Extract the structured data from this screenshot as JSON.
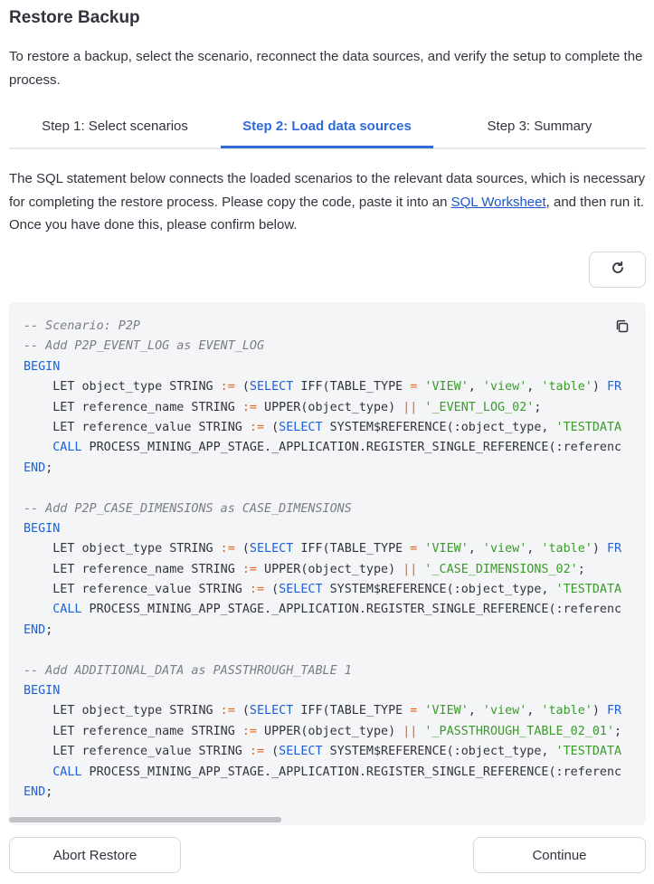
{
  "page": {
    "title": "Restore Backup",
    "intro": "To restore a backup, select the scenario, reconnect the data sources, and verify the setup to complete the process."
  },
  "tabs": [
    {
      "label": "Step 1: Select scenarios",
      "active": false
    },
    {
      "label": "Step 2: Load data sources",
      "active": true
    },
    {
      "label": "Step 3: Summary",
      "active": false
    }
  ],
  "description": {
    "before_link": "The SQL statement below connects the loaded scenarios to the relevant data sources, which is necessary for completing the restore process. Please copy the code, paste it into an ",
    "link_text": "SQL Worksheet",
    "after_link": ", and then run it. Once you have done this, please confirm below."
  },
  "icons": {
    "refresh": "refresh-icon",
    "copy": "copy-icon"
  },
  "code_lines": [
    [
      {
        "t": "-- Scenario: P2P",
        "c": "cm"
      }
    ],
    [
      {
        "t": "-- Add P2P_EVENT_LOG as EVENT_LOG",
        "c": "cm"
      }
    ],
    [
      {
        "t": "BEGIN",
        "c": "kw"
      }
    ],
    [
      {
        "t": "    LET object_type STRING "
      },
      {
        "t": ":=",
        "c": "op"
      },
      {
        "t": " ("
      },
      {
        "t": "SELECT",
        "c": "kw"
      },
      {
        "t": " IFF(TABLE_TYPE "
      },
      {
        "t": "=",
        "c": "op"
      },
      {
        "t": " "
      },
      {
        "t": "'VIEW'",
        "c": "st"
      },
      {
        "t": ", "
      },
      {
        "t": "'view'",
        "c": "st"
      },
      {
        "t": ", "
      },
      {
        "t": "'table'",
        "c": "st"
      },
      {
        "t": ") "
      },
      {
        "t": "FR",
        "c": "kw"
      }
    ],
    [
      {
        "t": "    LET reference_name STRING "
      },
      {
        "t": ":=",
        "c": "op"
      },
      {
        "t": " UPPER(object_type) "
      },
      {
        "t": "||",
        "c": "op"
      },
      {
        "t": " "
      },
      {
        "t": "'_EVENT_LOG_02'",
        "c": "st"
      },
      {
        "t": ";"
      }
    ],
    [
      {
        "t": "    LET reference_value STRING "
      },
      {
        "t": ":=",
        "c": "op"
      },
      {
        "t": " ("
      },
      {
        "t": "SELECT",
        "c": "kw"
      },
      {
        "t": " SYSTEM$REFERENCE(:object_type, "
      },
      {
        "t": "'TESTDATA",
        "c": "st"
      }
    ],
    [
      {
        "t": "    "
      },
      {
        "t": "CALL",
        "c": "kw"
      },
      {
        "t": " PROCESS_MINING_APP_STAGE._APPLICATION.REGISTER_SINGLE_REFERENCE(:referenc"
      }
    ],
    [
      {
        "t": "END",
        "c": "kw"
      },
      {
        "t": ";"
      }
    ],
    [
      {
        "t": ""
      }
    ],
    [
      {
        "t": "-- Add P2P_CASE_DIMENSIONS as CASE_DIMENSIONS",
        "c": "cm"
      }
    ],
    [
      {
        "t": "BEGIN",
        "c": "kw"
      }
    ],
    [
      {
        "t": "    LET object_type STRING "
      },
      {
        "t": ":=",
        "c": "op"
      },
      {
        "t": " ("
      },
      {
        "t": "SELECT",
        "c": "kw"
      },
      {
        "t": " IFF(TABLE_TYPE "
      },
      {
        "t": "=",
        "c": "op"
      },
      {
        "t": " "
      },
      {
        "t": "'VIEW'",
        "c": "st"
      },
      {
        "t": ", "
      },
      {
        "t": "'view'",
        "c": "st"
      },
      {
        "t": ", "
      },
      {
        "t": "'table'",
        "c": "st"
      },
      {
        "t": ") "
      },
      {
        "t": "FR",
        "c": "kw"
      }
    ],
    [
      {
        "t": "    LET reference_name STRING "
      },
      {
        "t": ":=",
        "c": "op"
      },
      {
        "t": " UPPER(object_type) "
      },
      {
        "t": "||",
        "c": "op"
      },
      {
        "t": " "
      },
      {
        "t": "'_CASE_DIMENSIONS_02'",
        "c": "st"
      },
      {
        "t": ";"
      }
    ],
    [
      {
        "t": "    LET reference_value STRING "
      },
      {
        "t": ":=",
        "c": "op"
      },
      {
        "t": " ("
      },
      {
        "t": "SELECT",
        "c": "kw"
      },
      {
        "t": " SYSTEM$REFERENCE(:object_type, "
      },
      {
        "t": "'TESTDATA",
        "c": "st"
      }
    ],
    [
      {
        "t": "    "
      },
      {
        "t": "CALL",
        "c": "kw"
      },
      {
        "t": " PROCESS_MINING_APP_STAGE._APPLICATION.REGISTER_SINGLE_REFERENCE(:referenc"
      }
    ],
    [
      {
        "t": "END",
        "c": "kw"
      },
      {
        "t": ";"
      }
    ],
    [
      {
        "t": ""
      }
    ],
    [
      {
        "t": "-- Add ADDITIONAL_DATA as PASSTHROUGH_TABLE 1",
        "c": "cm"
      }
    ],
    [
      {
        "t": "BEGIN",
        "c": "kw"
      }
    ],
    [
      {
        "t": "    LET object_type STRING "
      },
      {
        "t": ":=",
        "c": "op"
      },
      {
        "t": " ("
      },
      {
        "t": "SELECT",
        "c": "kw"
      },
      {
        "t": " IFF(TABLE_TYPE "
      },
      {
        "t": "=",
        "c": "op"
      },
      {
        "t": " "
      },
      {
        "t": "'VIEW'",
        "c": "st"
      },
      {
        "t": ", "
      },
      {
        "t": "'view'",
        "c": "st"
      },
      {
        "t": ", "
      },
      {
        "t": "'table'",
        "c": "st"
      },
      {
        "t": ") "
      },
      {
        "t": "FR",
        "c": "kw"
      }
    ],
    [
      {
        "t": "    LET reference_name STRING "
      },
      {
        "t": ":=",
        "c": "op"
      },
      {
        "t": " UPPER(object_type) "
      },
      {
        "t": "||",
        "c": "op"
      },
      {
        "t": " "
      },
      {
        "t": "'_PASSTHROUGH_TABLE_02_01'",
        "c": "st"
      },
      {
        "t": ";"
      }
    ],
    [
      {
        "t": "    LET reference_value STRING "
      },
      {
        "t": ":=",
        "c": "op"
      },
      {
        "t": " ("
      },
      {
        "t": "SELECT",
        "c": "kw"
      },
      {
        "t": " SYSTEM$REFERENCE(:object_type, "
      },
      {
        "t": "'TESTDATA",
        "c": "st"
      }
    ],
    [
      {
        "t": "    "
      },
      {
        "t": "CALL",
        "c": "kw"
      },
      {
        "t": " PROCESS_MINING_APP_STAGE._APPLICATION.REGISTER_SINGLE_REFERENCE(:referenc"
      }
    ],
    [
      {
        "t": "END",
        "c": "kw"
      },
      {
        "t": ";"
      }
    ]
  ],
  "buttons": {
    "abort": "Abort Restore",
    "continue": "Continue"
  },
  "colors": {
    "accent": "#2f6ad8",
    "link": "#1c55c7",
    "code_bg": "#f4f5f7",
    "keyword": "#1f60d6",
    "operator": "#e0661f",
    "string": "#3c9a2c",
    "comment": "#7a7d88"
  }
}
